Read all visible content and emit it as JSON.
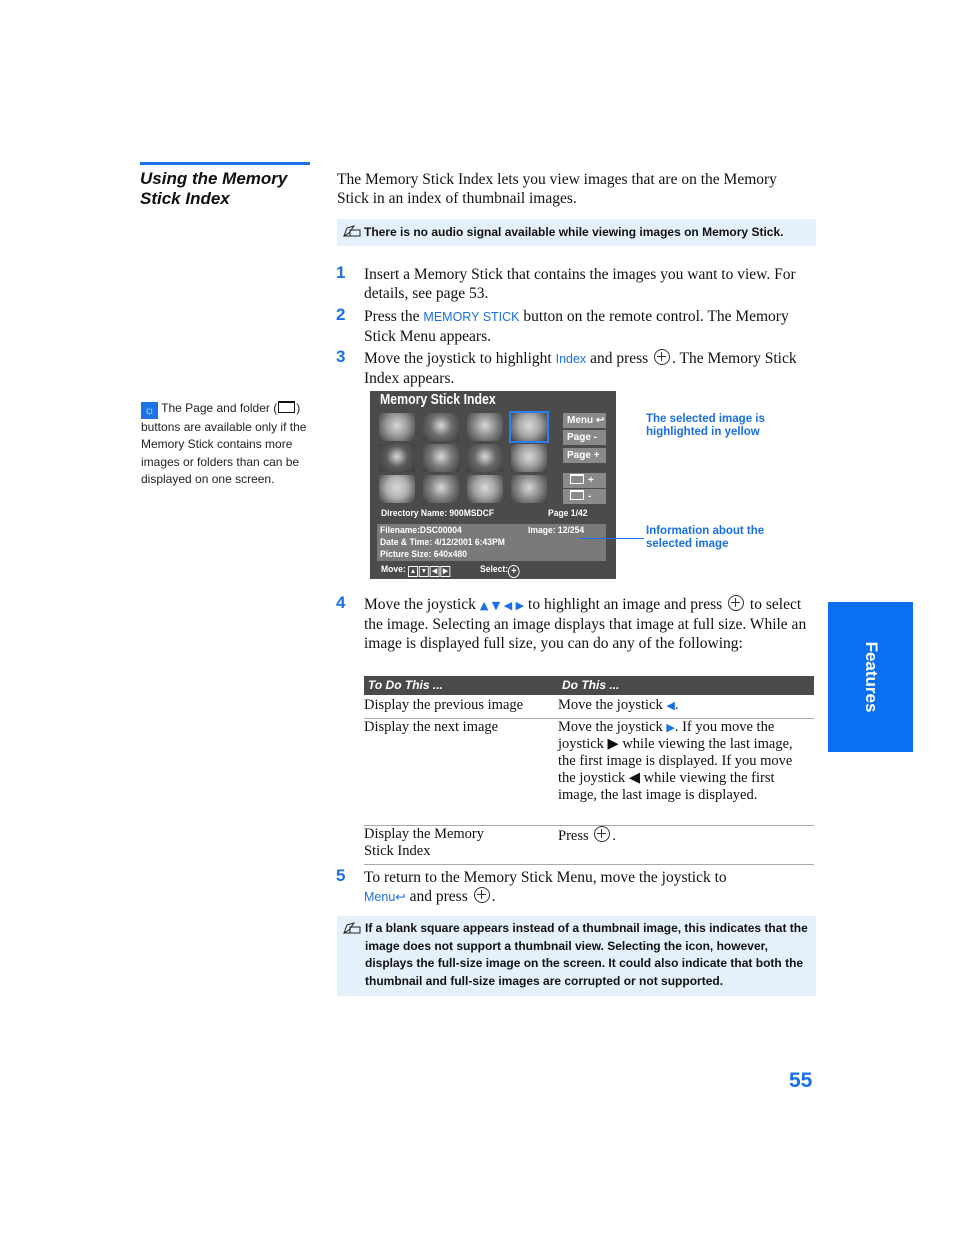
{
  "section": {
    "title_line1": "Using the Memory",
    "title_line2": "Stick Index"
  },
  "intro": "The Memory Stick Index lets you view images that are on the Memory Stick in an index of thumbnail images.",
  "note1": {
    "icon": "pencil-note-icon",
    "text": "There is no audio signal available while viewing images on Memory Stick."
  },
  "tip": {
    "icon": "lightbulb-tip-icon",
    "text_before": "The Page and folder (",
    "text_after": ") buttons are available only if the Memory Stick contains more images or folders than can be displayed on one screen."
  },
  "steps": [
    {
      "num": "1",
      "text": "Insert a Memory Stick that contains the images you want to view. For details, see page 53."
    },
    {
      "num": "2",
      "pre": "Press the ",
      "kw": "MEMORY STICK",
      "post": " button on the remote control. The Memory Stick Menu appears."
    },
    {
      "num": "3",
      "pre": "Move the joystick to highlight ",
      "kw": "Index",
      "mid": " and press ",
      "post": ". The Memory Stick Index appears."
    },
    {
      "num": "4",
      "pre": "Move the joystick ",
      "arrows": "▲ ▼ ◀ ▶",
      "mid": " to highlight an image and press ",
      "post": " to select the image. Selecting an image displays that image at full size. While an image is displayed full size, you can do any of the following:"
    },
    {
      "num": "5",
      "pre": "To return to the Memory Stick Menu, move the joystick to",
      "kw": "Menu↩",
      "post": " and press ",
      "end": "."
    }
  ],
  "screen": {
    "title": "Memory Stick Index",
    "thumbnail_count": 12,
    "selected_thumbnail_index": 3,
    "buttons": [
      "Menu ↩",
      "Page -",
      "Page +",
      "+",
      "-"
    ],
    "directory": "Directory Name: 900MSDCF",
    "page": "Page 1/42",
    "filename": "Filename:DSC00004",
    "image": "Image: 12/254",
    "datetime": "Date & Time: 4/12/2001 6:43PM",
    "picture_size": "Picture Size: 640x480",
    "move_label": "Move:",
    "select_label": "Select:"
  },
  "callouts": {
    "selected": "The selected image is highlighted in yellow",
    "information": "Information about the selected image"
  },
  "table": {
    "headers": [
      "To Do This ...",
      "Do This ..."
    ],
    "rows": [
      {
        "todo": "Display the previous image",
        "do_pre": "Move the joystick ",
        "do_arrow": "◀",
        "do_post": "."
      },
      {
        "todo": "Display the next image",
        "do_pre": "Move the joystick ",
        "do_arrow": "▶",
        "do_post": ". If you move the joystick ▶ while viewing the last image, the first image is displayed. If you move the joystick ◀ while viewing the first image, the last image is displayed."
      },
      {
        "todo": "Display the Memory Stick Index",
        "do_pre": "Press ",
        "do_post": "."
      }
    ]
  },
  "note2": {
    "icon": "pencil-note-icon",
    "text": "If a blank square appears instead of a thumbnail image, this indicates that the image does not support a thumbnail view. Selecting the icon, however, displays the full-size image on the screen. It could also indicate that both the thumbnail and full-size images are corrupted or not supported."
  },
  "side_tab": "Features",
  "page_number": "55",
  "colors": {
    "accent_blue": "#1a6fe8",
    "note_bg": "#e5f0fd",
    "screen_bg": "#4b4b4b",
    "table_header_bg": "#4a4a4a"
  }
}
